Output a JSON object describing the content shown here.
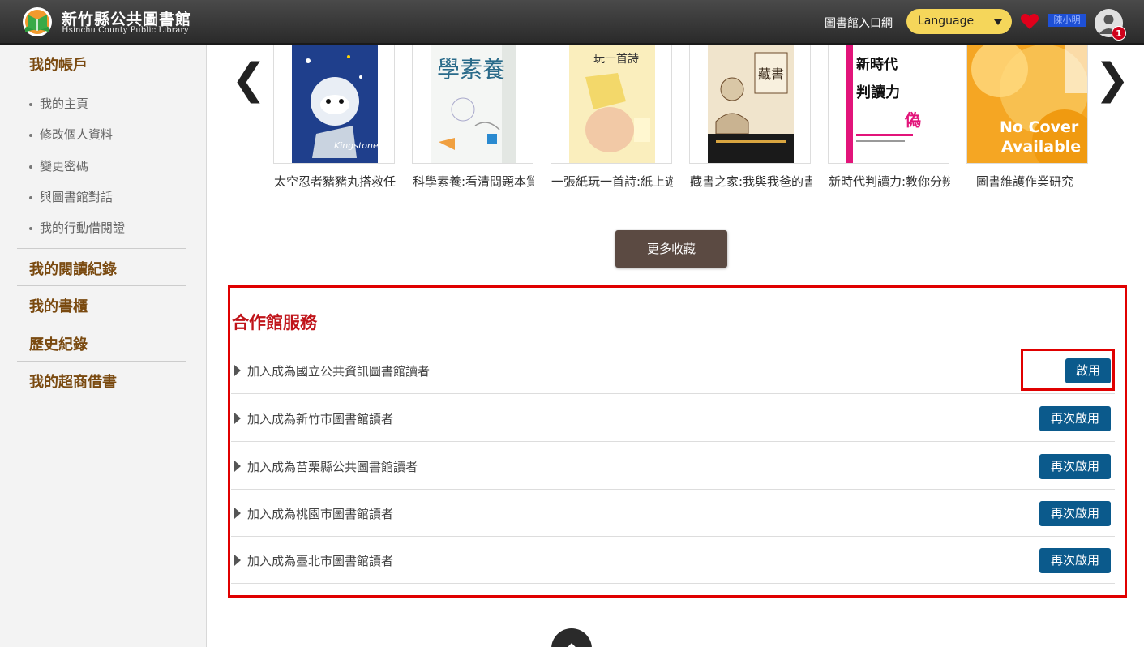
{
  "header": {
    "logo_zh": "新竹縣公共圖書館",
    "logo_en": "Hsinchu County Public Library",
    "portal_link": "圖書館入口網",
    "language_label": "Language",
    "user_name": "陳小明",
    "notification_count": "1",
    "heart_color": "#e0001b"
  },
  "sidebar": {
    "section_account": "我的帳戶",
    "items": [
      "我的主頁",
      "修改個人資料",
      "變更密碼",
      "與圖書館對話",
      "我的行動借閱證"
    ],
    "section_reading": "我的閱讀紀錄",
    "section_shelf": "我的書櫃",
    "section_history": "歷史紀錄",
    "section_store": "我的超商借書"
  },
  "carousel": {
    "books": [
      {
        "title": "太空忍者豬豬丸搭救任務",
        "cover_text": "Kingstone"
      },
      {
        "title": "科學素養:看清問題本質",
        "cover_text": "學素養"
      },
      {
        "title": "一張紙玩一首詩:紙上遊戲",
        "cover_text": "玩一首詩"
      },
      {
        "title": "藏書之家:我與我爸的書",
        "cover_text": "藏書"
      },
      {
        "title": "新時代判讀力:教你分辨真偽",
        "cover_text": "判讀力"
      },
      {
        "title": "圖書維護作業研究",
        "cover_text": "No Cover Available"
      }
    ],
    "more_button": "更多收藏"
  },
  "partner": {
    "title": "合作館服務",
    "rows": [
      {
        "label": "加入成為國立公共資訊圖書館讀者",
        "button": "啟用"
      },
      {
        "label": "加入成為新竹市圖書館讀者",
        "button": "再次啟用"
      },
      {
        "label": "加入成為苗栗縣公共圖書館讀者",
        "button": "再次啟用"
      },
      {
        "label": "加入成為桃園市圖書館讀者",
        "button": "再次啟用"
      },
      {
        "label": "加入成為臺北市圖書館讀者",
        "button": "再次啟用"
      }
    ]
  },
  "colors": {
    "accent_red": "#e00000",
    "button_blue": "#0b5a8c",
    "sidebar_brown": "#7a4a10"
  }
}
